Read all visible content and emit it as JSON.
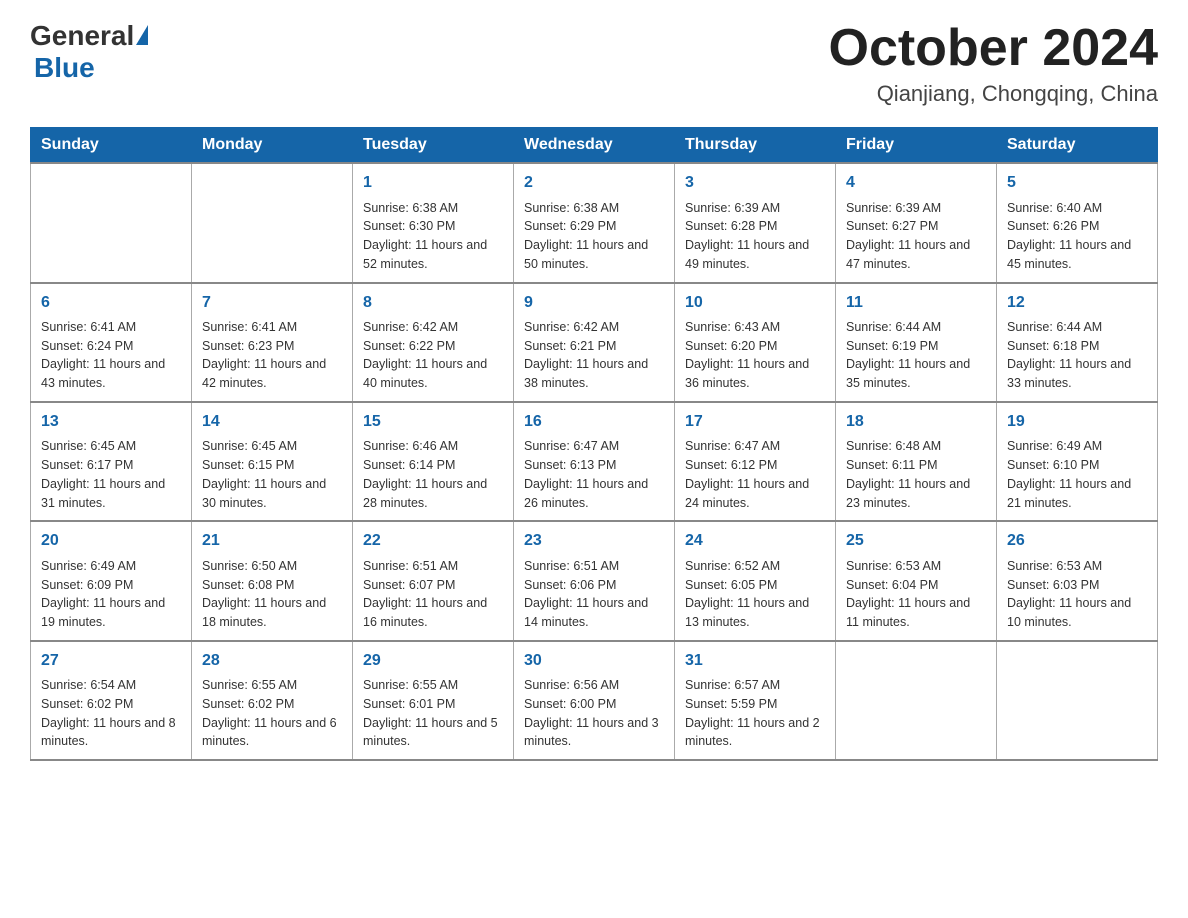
{
  "header": {
    "logo_general": "General",
    "logo_blue": "Blue",
    "title": "October 2024",
    "subtitle": "Qianjiang, Chongqing, China"
  },
  "days_of_week": [
    "Sunday",
    "Monday",
    "Tuesday",
    "Wednesday",
    "Thursday",
    "Friday",
    "Saturday"
  ],
  "weeks": [
    [
      {
        "day": "",
        "sunrise": "",
        "sunset": "",
        "daylight": ""
      },
      {
        "day": "",
        "sunrise": "",
        "sunset": "",
        "daylight": ""
      },
      {
        "day": "1",
        "sunrise": "Sunrise: 6:38 AM",
        "sunset": "Sunset: 6:30 PM",
        "daylight": "Daylight: 11 hours and 52 minutes."
      },
      {
        "day": "2",
        "sunrise": "Sunrise: 6:38 AM",
        "sunset": "Sunset: 6:29 PM",
        "daylight": "Daylight: 11 hours and 50 minutes."
      },
      {
        "day": "3",
        "sunrise": "Sunrise: 6:39 AM",
        "sunset": "Sunset: 6:28 PM",
        "daylight": "Daylight: 11 hours and 49 minutes."
      },
      {
        "day": "4",
        "sunrise": "Sunrise: 6:39 AM",
        "sunset": "Sunset: 6:27 PM",
        "daylight": "Daylight: 11 hours and 47 minutes."
      },
      {
        "day": "5",
        "sunrise": "Sunrise: 6:40 AM",
        "sunset": "Sunset: 6:26 PM",
        "daylight": "Daylight: 11 hours and 45 minutes."
      }
    ],
    [
      {
        "day": "6",
        "sunrise": "Sunrise: 6:41 AM",
        "sunset": "Sunset: 6:24 PM",
        "daylight": "Daylight: 11 hours and 43 minutes."
      },
      {
        "day": "7",
        "sunrise": "Sunrise: 6:41 AM",
        "sunset": "Sunset: 6:23 PM",
        "daylight": "Daylight: 11 hours and 42 minutes."
      },
      {
        "day": "8",
        "sunrise": "Sunrise: 6:42 AM",
        "sunset": "Sunset: 6:22 PM",
        "daylight": "Daylight: 11 hours and 40 minutes."
      },
      {
        "day": "9",
        "sunrise": "Sunrise: 6:42 AM",
        "sunset": "Sunset: 6:21 PM",
        "daylight": "Daylight: 11 hours and 38 minutes."
      },
      {
        "day": "10",
        "sunrise": "Sunrise: 6:43 AM",
        "sunset": "Sunset: 6:20 PM",
        "daylight": "Daylight: 11 hours and 36 minutes."
      },
      {
        "day": "11",
        "sunrise": "Sunrise: 6:44 AM",
        "sunset": "Sunset: 6:19 PM",
        "daylight": "Daylight: 11 hours and 35 minutes."
      },
      {
        "day": "12",
        "sunrise": "Sunrise: 6:44 AM",
        "sunset": "Sunset: 6:18 PM",
        "daylight": "Daylight: 11 hours and 33 minutes."
      }
    ],
    [
      {
        "day": "13",
        "sunrise": "Sunrise: 6:45 AM",
        "sunset": "Sunset: 6:17 PM",
        "daylight": "Daylight: 11 hours and 31 minutes."
      },
      {
        "day": "14",
        "sunrise": "Sunrise: 6:45 AM",
        "sunset": "Sunset: 6:15 PM",
        "daylight": "Daylight: 11 hours and 30 minutes."
      },
      {
        "day": "15",
        "sunrise": "Sunrise: 6:46 AM",
        "sunset": "Sunset: 6:14 PM",
        "daylight": "Daylight: 11 hours and 28 minutes."
      },
      {
        "day": "16",
        "sunrise": "Sunrise: 6:47 AM",
        "sunset": "Sunset: 6:13 PM",
        "daylight": "Daylight: 11 hours and 26 minutes."
      },
      {
        "day": "17",
        "sunrise": "Sunrise: 6:47 AM",
        "sunset": "Sunset: 6:12 PM",
        "daylight": "Daylight: 11 hours and 24 minutes."
      },
      {
        "day": "18",
        "sunrise": "Sunrise: 6:48 AM",
        "sunset": "Sunset: 6:11 PM",
        "daylight": "Daylight: 11 hours and 23 minutes."
      },
      {
        "day": "19",
        "sunrise": "Sunrise: 6:49 AM",
        "sunset": "Sunset: 6:10 PM",
        "daylight": "Daylight: 11 hours and 21 minutes."
      }
    ],
    [
      {
        "day": "20",
        "sunrise": "Sunrise: 6:49 AM",
        "sunset": "Sunset: 6:09 PM",
        "daylight": "Daylight: 11 hours and 19 minutes."
      },
      {
        "day": "21",
        "sunrise": "Sunrise: 6:50 AM",
        "sunset": "Sunset: 6:08 PM",
        "daylight": "Daylight: 11 hours and 18 minutes."
      },
      {
        "day": "22",
        "sunrise": "Sunrise: 6:51 AM",
        "sunset": "Sunset: 6:07 PM",
        "daylight": "Daylight: 11 hours and 16 minutes."
      },
      {
        "day": "23",
        "sunrise": "Sunrise: 6:51 AM",
        "sunset": "Sunset: 6:06 PM",
        "daylight": "Daylight: 11 hours and 14 minutes."
      },
      {
        "day": "24",
        "sunrise": "Sunrise: 6:52 AM",
        "sunset": "Sunset: 6:05 PM",
        "daylight": "Daylight: 11 hours and 13 minutes."
      },
      {
        "day": "25",
        "sunrise": "Sunrise: 6:53 AM",
        "sunset": "Sunset: 6:04 PM",
        "daylight": "Daylight: 11 hours and 11 minutes."
      },
      {
        "day": "26",
        "sunrise": "Sunrise: 6:53 AM",
        "sunset": "Sunset: 6:03 PM",
        "daylight": "Daylight: 11 hours and 10 minutes."
      }
    ],
    [
      {
        "day": "27",
        "sunrise": "Sunrise: 6:54 AM",
        "sunset": "Sunset: 6:02 PM",
        "daylight": "Daylight: 11 hours and 8 minutes."
      },
      {
        "day": "28",
        "sunrise": "Sunrise: 6:55 AM",
        "sunset": "Sunset: 6:02 PM",
        "daylight": "Daylight: 11 hours and 6 minutes."
      },
      {
        "day": "29",
        "sunrise": "Sunrise: 6:55 AM",
        "sunset": "Sunset: 6:01 PM",
        "daylight": "Daylight: 11 hours and 5 minutes."
      },
      {
        "day": "30",
        "sunrise": "Sunrise: 6:56 AM",
        "sunset": "Sunset: 6:00 PM",
        "daylight": "Daylight: 11 hours and 3 minutes."
      },
      {
        "day": "31",
        "sunrise": "Sunrise: 6:57 AM",
        "sunset": "Sunset: 5:59 PM",
        "daylight": "Daylight: 11 hours and 2 minutes."
      },
      {
        "day": "",
        "sunrise": "",
        "sunset": "",
        "daylight": ""
      },
      {
        "day": "",
        "sunrise": "",
        "sunset": "",
        "daylight": ""
      }
    ]
  ]
}
